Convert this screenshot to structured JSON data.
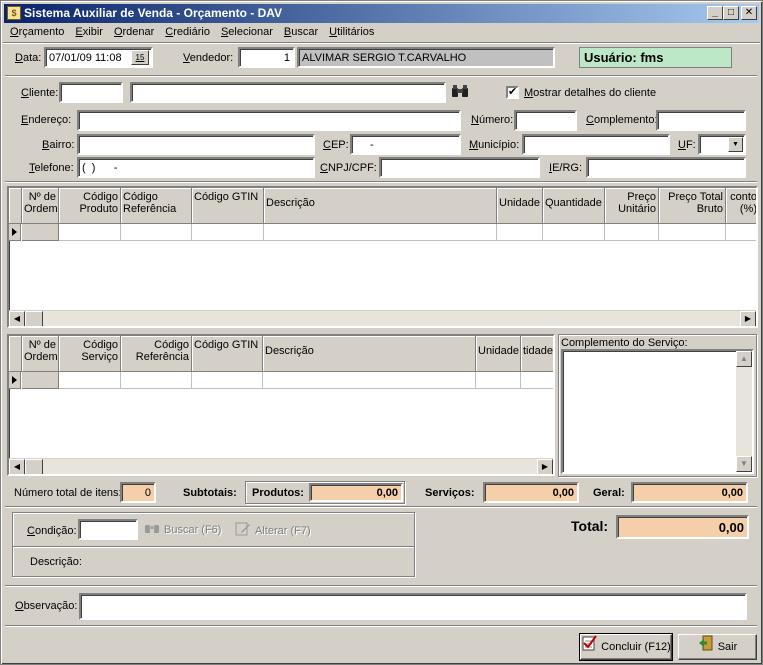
{
  "window": {
    "title": "Sistema Auxiliar de Venda - Orçamento - DAV",
    "minimize": "_",
    "maximize": "□",
    "close": "✕"
  },
  "menu": [
    "Orçamento",
    "Exibir",
    "Ordenar",
    "Crediário",
    "Selecionar",
    "Buscar",
    "Utilitários"
  ],
  "header": {
    "data_label": "Data:",
    "data_value": "07/01/09 11:08",
    "calendar_btn": "15",
    "vendedor_label": "Vendedor:",
    "vendedor_code": "1",
    "vendedor_name": "ALVIMAR SERGIO T.CARVALHO",
    "usuario": "Usuário: fms"
  },
  "cliente": {
    "cliente_label": "Cliente:",
    "mostrar_detalhes": "Mostrar detalhes do cliente",
    "mostrar_detalhes_checked": "✔",
    "endereco_label": "Endereço:",
    "numero_label": "Número:",
    "complemento_label": "Complemento:",
    "bairro_label": "Bairro:",
    "cep_label": "CEP:",
    "cep_value": "-",
    "municipio_label": "Município:",
    "uf_label": "UF:",
    "telefone_label": "Telefone:",
    "telefone_value": "(  )      -",
    "cnpj_label": "CNPJ/CPF:",
    "ierg_label": "IE/RG:"
  },
  "produtos_grid": {
    "columns": [
      "Nº de Ordem",
      "Código Produto",
      "Código Referência",
      "Código GTIN",
      "Descrição",
      "Unidade",
      "Quantidade",
      "Preço Unitário",
      "Preço Total Bruto",
      "conto (%)"
    ]
  },
  "servicos_grid": {
    "columns": [
      "Nº de Ordem",
      "Código Serviço",
      "Código Referência",
      "Código GTIN",
      "Descrição",
      "Unidade",
      "tidade"
    ],
    "complemento_label": "Complemento do Serviço:"
  },
  "totais": {
    "numero_itens_label": "Número total de itens:",
    "numero_itens": "0",
    "subtotais_label": "Subtotais:",
    "produtos_label": "Produtos:",
    "produtos_value": "0,00",
    "servicos_label": "Serviços:",
    "servicos_value": "0,00",
    "geral_label": "Geral:",
    "geral_value": "0,00",
    "total_label": "Total:",
    "total_value": "0,00"
  },
  "condicao": {
    "condicao_label": "Condição:",
    "buscar_label": "Buscar (F6)",
    "alterar_label": "Alterar (F7)",
    "descricao_label": "Descrição:"
  },
  "observacao_label": "Observação:",
  "footer": {
    "concluir_label": "Concluir (F12)",
    "sair_label": "Sair"
  }
}
